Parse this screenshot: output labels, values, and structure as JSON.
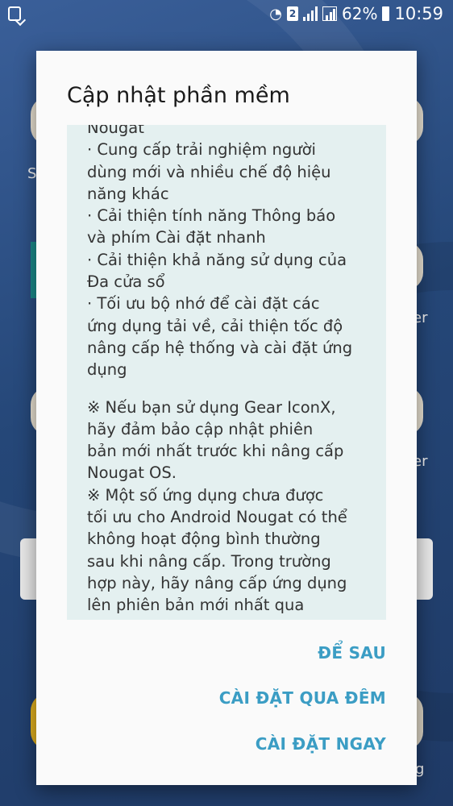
{
  "status_bar": {
    "sim_slot": "2",
    "battery": "62%",
    "time": "10:59"
  },
  "background_fragments": [
    "S",
    "er",
    "er",
    "g"
  ],
  "dialog": {
    "title": "Cập nhật phần mềm",
    "content": [
      "Nougat",
      "· Cung cấp trải nghiệm người",
      "dùng mới và nhiều chế độ hiệu",
      "năng khác",
      "· Cải thiện tính năng Thông báo",
      "và phím Cài đặt nhanh",
      "· Cải thiện khả năng sử dụng của",
      "Đa cửa sổ",
      "· Tối ưu bộ nhớ để cài đặt các",
      "ứng dụng tải về, cải thiện tốc độ",
      "nâng cấp hệ thống và cài đặt ứng",
      "dụng",
      "",
      "※ Nếu bạn sử dụng Gear IconX,",
      "hãy đảm bảo cập nhật phiên",
      "bản mới nhất trước khi nâng cấp",
      "Nougat OS.",
      "※ Một số ứng dụng chưa được",
      "tối ưu cho Android Nougat có thể",
      "không hoạt động bình thường",
      "sau khi nâng cấp. Trong trường",
      "hợp này, hãy nâng cấp ứng dụng",
      "lên phiên bản mới nhất qua"
    ],
    "actions": {
      "later": "ĐỂ SAU",
      "overnight": "CÀI ĐẶT QUA ĐÊM",
      "now": "CÀI ĐẶT NGAY"
    }
  },
  "colors": {
    "accent": "#3b9dc4",
    "content_bg": "#e4f0f0",
    "dialog_bg": "#fafafa"
  }
}
